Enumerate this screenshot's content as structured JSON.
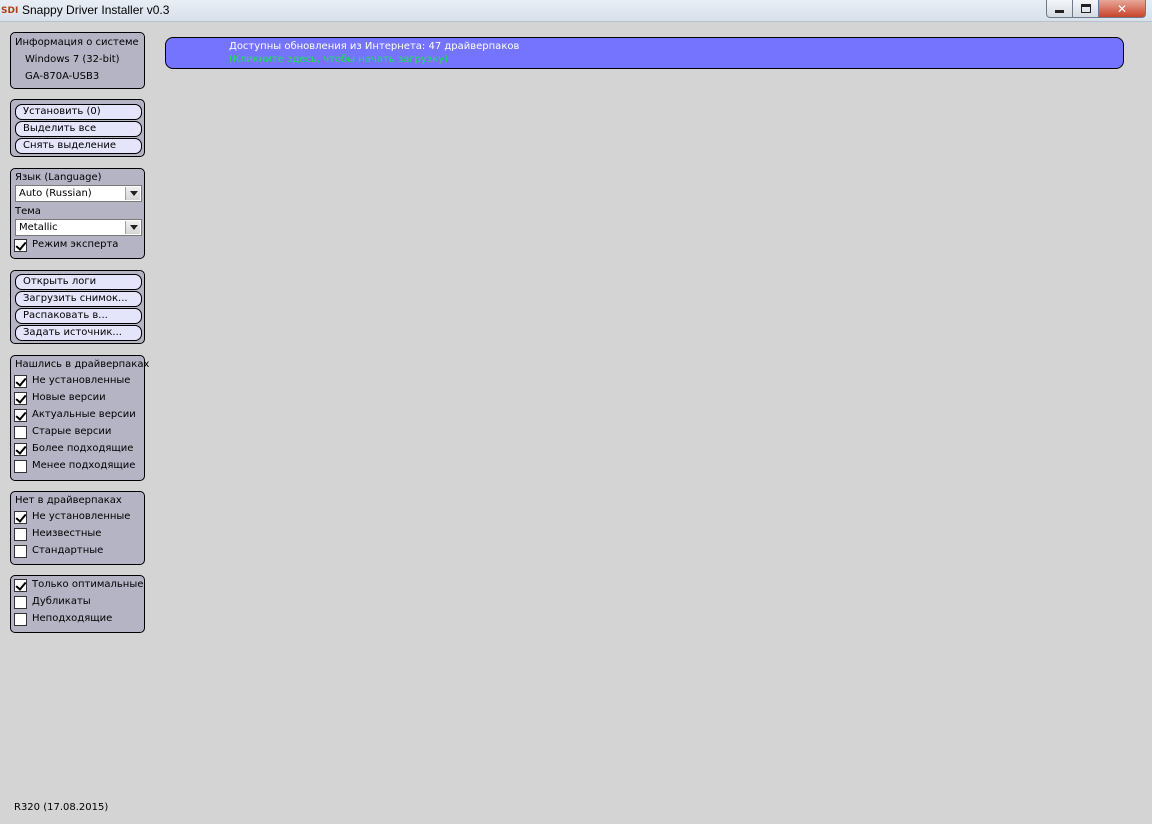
{
  "window": {
    "title": "Snappy Driver Installer v0.3",
    "app_icon": "sdi-app-icon",
    "icon_text": "SDI"
  },
  "system_info": {
    "title": "Информация о системе",
    "os": "Windows 7 (32-bit)",
    "board": "GA-870A-USB3"
  },
  "actions": {
    "install": "Установить (0)",
    "select_all": "Выделить все",
    "deselect": "Снять выделение"
  },
  "settings": {
    "language_label": "Язык (Language)",
    "language_value": "Auto (Russian)",
    "theme_label": "Тема",
    "theme_value": "Metallic",
    "expert_mode": {
      "label": "Режим эксперта",
      "checked": true
    }
  },
  "tools": {
    "open_logs": "Открыть логи",
    "load_snapshot": "Загрузить снимок...",
    "extract_to": "Распаковать в...",
    "set_source": "Задать источник..."
  },
  "found_in_packs": {
    "title": "Нашлись в драйверпаках",
    "items": [
      {
        "label": "Не установленные",
        "checked": true
      },
      {
        "label": "Новые версии",
        "checked": true
      },
      {
        "label": "Актуальные версии",
        "checked": true
      },
      {
        "label": "Старые версии",
        "checked": false
      },
      {
        "label": "Более подходящие",
        "checked": true
      },
      {
        "label": "Менее подходящие",
        "checked": false
      }
    ]
  },
  "not_in_packs": {
    "title": "Нет в драйверпаках",
    "items": [
      {
        "label": "Не установленные",
        "checked": true
      },
      {
        "label": "Неизвестные",
        "checked": false
      },
      {
        "label": "Стандартные",
        "checked": false
      }
    ]
  },
  "options": {
    "items": [
      {
        "label": "Только оптимальные",
        "checked": true
      },
      {
        "label": "Дубликаты",
        "checked": false
      },
      {
        "label": "Неподходящие",
        "checked": false
      }
    ]
  },
  "update_banner": {
    "line1": "Доступны обновления из Интернета: 47 драйверпаков",
    "line2": "(Кликните здесь, чтобы начать загрузку)",
    "color": "#7474ff",
    "link_color": "#22e05a"
  },
  "revision": "R320 (17.08.2015)"
}
